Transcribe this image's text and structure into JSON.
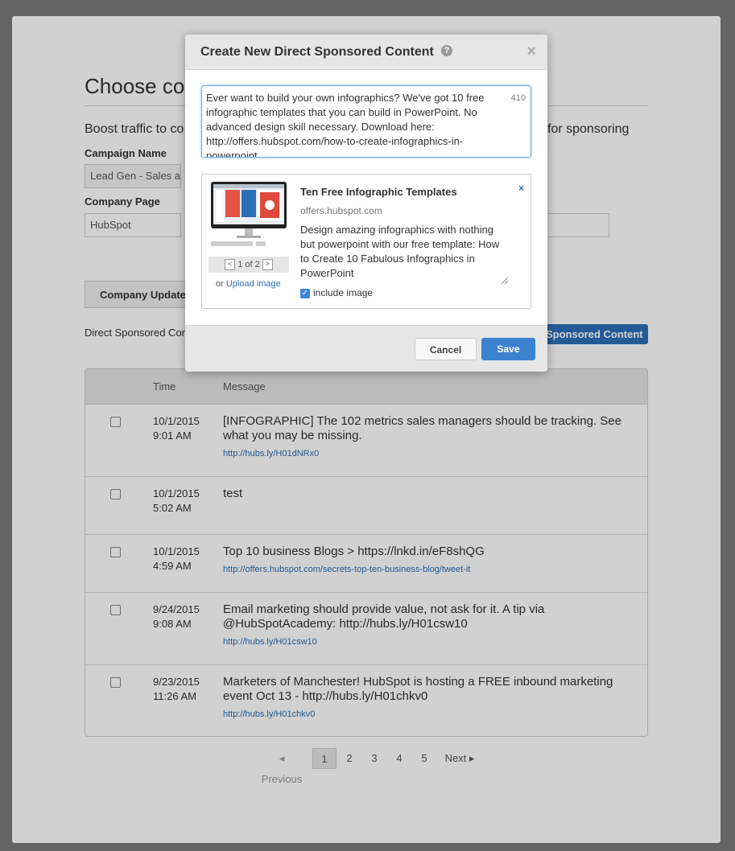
{
  "background": {
    "title": "Choose con",
    "boost_left": "Boost traffic to co",
    "boost_right": "for sponsoring",
    "campaign_label": "Campaign Name",
    "campaign_value": "Lead Gen - Sales and",
    "company_label": "Company Page",
    "company_value": "HubSpot",
    "tab_label": "Company Update",
    "dsc_label": "Direct Sponsored Con",
    "dsc_button": "Sponsored Content"
  },
  "table": {
    "col_time": "Time",
    "col_message": "Message",
    "rows": [
      {
        "date": "10/1/2015",
        "time": "9:01 AM",
        "message": "[INFOGRAPHIC] The 102 metrics sales managers should be tracking. See what you may be missing.",
        "link": "http://hubs.ly/H01dNRx0"
      },
      {
        "date": "10/1/2015",
        "time": "5:02 AM",
        "message": "test",
        "link": ""
      },
      {
        "date": "10/1/2015",
        "time": "4:59 AM",
        "message": "Top 10 business Blogs > https://lnkd.in/eF8shQG",
        "link": "http://offers.hubspot.com/secrets-top-ten-business-blog/tweet-it"
      },
      {
        "date": "9/24/2015",
        "time": "9:08 AM",
        "message": "Email marketing should provide value, not ask for it. A tip via @HubSpotAcademy: http://hubs.ly/H01csw10",
        "link": "http://hubs.ly/H01csw10"
      },
      {
        "date": "9/23/2015",
        "time": "11:26 AM",
        "message": "Marketers of Manchester! HubSpot is hosting a FREE inbound marketing event Oct 13 - http://hubs.ly/H01chkv0",
        "link": "http://hubs.ly/H01chkv0"
      }
    ]
  },
  "pagination": {
    "previous": "Previous",
    "pages": [
      "1",
      "2",
      "3",
      "4",
      "5"
    ],
    "next": "Next"
  },
  "modal": {
    "title": "Create New Direct Sponsored Content",
    "help": "?",
    "close": "×",
    "text": "Ever want to build your own infographics? We've got 10 free infographic templates that you can build in PowerPoint. No advanced design skill necessary. Download here: http://offers.hubspot.com/how-to-create-infographics-in-powerpoint",
    "char_count": "410",
    "preview": {
      "title": "Ten Free Infographic Templates",
      "remove": "×",
      "domain": "offers.hubspot.com",
      "description": "Design amazing infographics with nothing but powerpoint with our free template: How to Create 10 Fabulous Infographics in PowerPoint",
      "image_nav": "1 of 2",
      "upload_prefix": "or",
      "upload_link": "Upload image",
      "include_image": "include image"
    },
    "cancel": "Cancel",
    "save": "Save"
  },
  "colors": {
    "accent": "#3d82cf",
    "link": "#2a6db1"
  }
}
